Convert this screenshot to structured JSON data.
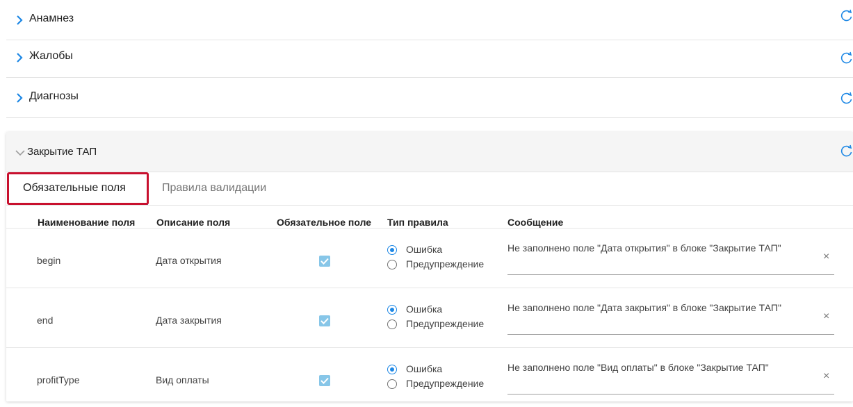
{
  "sections": [
    {
      "label": "Анамнез"
    },
    {
      "label": "Жалобы"
    },
    {
      "label": "Диагнозы"
    }
  ],
  "panel": {
    "title": "Закрытие ТАП",
    "tabs": [
      {
        "label": "Обязательные поля",
        "active": true
      },
      {
        "label": "Правила валидации",
        "active": false
      }
    ],
    "columns": [
      "Наименование поля",
      "Описание поля",
      "Обязательное поле",
      "Тип правила",
      "Сообщение"
    ],
    "rows": [
      {
        "name": "begin",
        "description": "Дата открытия",
        "required": true,
        "rule_selected": "Ошибка",
        "rule_other": "Предупреждение",
        "message": "Не заполнено поле \"Дата открытия\" в блоке \"Закрытие ТАП\""
      },
      {
        "name": "end",
        "description": "Дата закрытия",
        "required": true,
        "rule_selected": "Ошибка",
        "rule_other": "Предупреждение",
        "message": "Не заполнено поле \"Дата закрытия\" в блоке \"Закрытие ТАП\""
      },
      {
        "name": "profitType",
        "description": "Вид оплаты",
        "required": true,
        "rule_selected": "Ошибка",
        "rule_other": "Предупреждение",
        "message": "Не заполнено поле \"Вид оплаты\" в блоке \"Закрытие ТАП\""
      }
    ]
  },
  "colors": {
    "accent": "#1e88e5",
    "highlight": "#c8102e",
    "checkbox": "#87c6e8"
  }
}
